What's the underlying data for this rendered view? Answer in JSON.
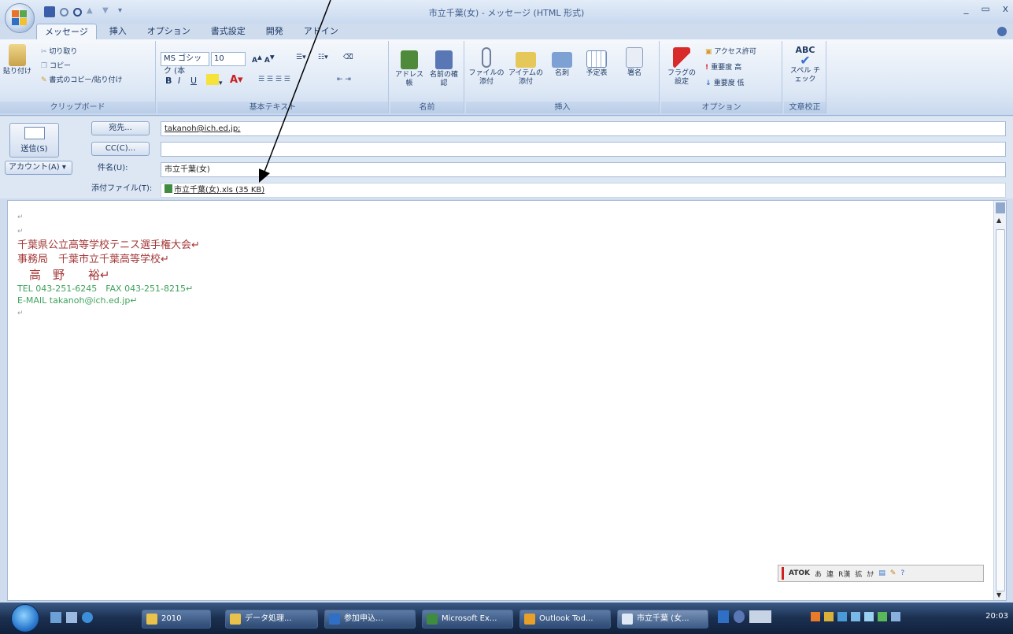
{
  "window": {
    "title": "市立千葉(女) - メッセージ (HTML 形式)",
    "controls": [
      "_",
      "▭",
      "x"
    ]
  },
  "tabs": [
    "メッセージ",
    "挿入",
    "オプション",
    "書式設定",
    "開発",
    "アドイン"
  ],
  "ribbon": {
    "clipboard": {
      "paste": "貼り付け",
      "cut": "切り取り",
      "copy": "コピー",
      "format_painter": "書式のコピー/貼り付け",
      "label": "クリップボード"
    },
    "basic_text": {
      "font_name": "MS ゴシック (本",
      "font_size": "10",
      "label": "基本テキスト"
    },
    "names": {
      "address_book": "アドレス帳",
      "check_names": "名前の確認",
      "label": "名前"
    },
    "include": {
      "attach_file": "ファイルの添付",
      "attach_item": "アイテムの添付",
      "business_card": "名刺",
      "calendar": "予定表",
      "signature": "署名",
      "label": "挿入"
    },
    "options": {
      "follow_up": "フラグの設定",
      "permission": "アクセス許可",
      "high_importance": "重要度 高",
      "low_importance": "重要度 低",
      "label": "オプション"
    },
    "proofing": {
      "spelling": "スペル チェック",
      "label": "文章校正"
    }
  },
  "form": {
    "send": "送信(S)",
    "account": "アカウント(A)",
    "to_button": "宛先...",
    "cc_button": "CC(C)...",
    "subject_label": "件名(U):",
    "attach_label": "添付ファイル(T):",
    "to_value": "takanoh@ich.ed.jp;",
    "cc_value": "",
    "subject_value": "市立千葉(女)",
    "attachment": "市立千葉(女).xls (35 KB)"
  },
  "message": {
    "blank1": "↵",
    "blank2": "↵",
    "line1": "千葉県公立高等学校テニス選手権大会↵",
    "line2": "事務局　千葉市立千葉高等学校↵",
    "line3": "　高　野　　裕↵",
    "line4": "TEL 043-251-6245　FAX 043-251-8215↵",
    "line5": "E-MAIL takanoh@ich.ed.jp↵",
    "blank3": "↵"
  },
  "atok": [
    "ATOK",
    "あ",
    "連",
    "R漢",
    "拡",
    "ｶﾅ",
    "▤",
    "✎",
    "?"
  ],
  "taskbar": {
    "items": [
      "2010",
      "データ処理...",
      "参加申込…",
      "Microsoft Ex...",
      "Outlook Tod...",
      "市立千葉 (女..."
    ],
    "clock": "20:03"
  },
  "colors": {
    "accent": "#1e3a64",
    "maroon_text": "#a33838",
    "green_text": "#3fa25c"
  }
}
